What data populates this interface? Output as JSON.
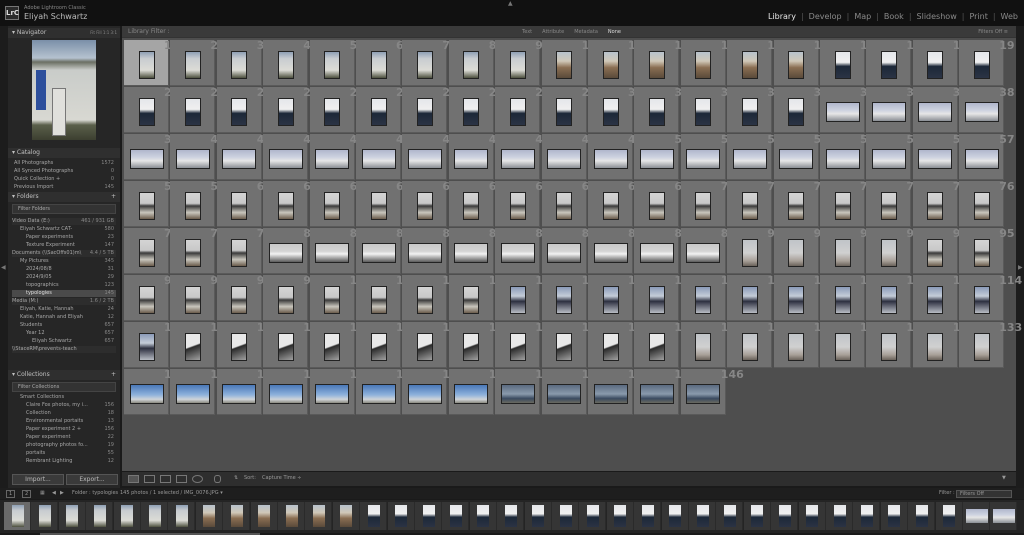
{
  "app": {
    "product": "Adobe Lightroom Classic",
    "user": "Eliyah Schwartz",
    "logo": "LrC"
  },
  "modules": [
    "Library",
    "Develop",
    "Map",
    "Book",
    "Slideshow",
    "Print",
    "Web"
  ],
  "active_module": "Library",
  "left_panel": {
    "navigator": {
      "title": "Navigator",
      "opts": "Fit  Fill  1:1  3:1"
    },
    "catalog": {
      "title": "Catalog",
      "items": [
        {
          "label": "All Photographs",
          "count": "1572"
        },
        {
          "label": "All Synced Photographs",
          "count": "0"
        },
        {
          "label": "Quick Collection +",
          "count": "0"
        },
        {
          "label": "Previous Import",
          "count": "145"
        }
      ]
    },
    "folders": {
      "title": "Folders",
      "filter": "Filter Folders",
      "items": [
        {
          "label": "Video Data (E:)",
          "count": "461 / 931 GB",
          "level": 0,
          "volume": true
        },
        {
          "label": "Eliyah Schwartz CAT-",
          "count": "580",
          "level": 1
        },
        {
          "label": "Paper experiments",
          "count": "23",
          "level": 2
        },
        {
          "label": "Texture Experiment",
          "count": "147",
          "level": 2
        },
        {
          "label": "Documents (\\\\SacOffs01)m\\",
          "count": "4.4 / 5 TB",
          "level": 0,
          "volume": true
        },
        {
          "label": "My Pictures",
          "count": "345",
          "level": 1
        },
        {
          "label": "2024/08/8",
          "count": "31",
          "level": 2
        },
        {
          "label": "2024/9/05",
          "count": "29",
          "level": 2
        },
        {
          "label": "topographics",
          "count": "123",
          "level": 2
        },
        {
          "label": "typologies",
          "count": "145",
          "level": 2,
          "selected": true
        },
        {
          "label": "Media (M:)",
          "count": "1.6 / 2 TB",
          "level": 0,
          "volume": true
        },
        {
          "label": "Eliyah, Katie, Hannah",
          "count": "24",
          "level": 1
        },
        {
          "label": "Katie, Hannah and Eliyah",
          "count": "12",
          "level": 1
        },
        {
          "label": "Students",
          "count": "657",
          "level": 1
        },
        {
          "label": "Year 12",
          "count": "657",
          "level": 2
        },
        {
          "label": "Eliyah Schwartz",
          "count": "657",
          "level": 3
        },
        {
          "label": "\\\\StaceRM\\prevents-teach",
          "count": "",
          "level": 0,
          "volume": true
        }
      ]
    },
    "collections": {
      "title": "Collections",
      "filter": "Filter Collections",
      "items": [
        {
          "label": "Smart Collections",
          "count": "",
          "level": 1
        },
        {
          "label": "Claire Fox photos, my i...",
          "count": "156",
          "level": 2
        },
        {
          "label": "Collection",
          "count": "18",
          "level": 2
        },
        {
          "label": "Environmental portaits",
          "count": "13",
          "level": 2
        },
        {
          "label": "Paper experiment 2 +",
          "count": "156",
          "level": 2
        },
        {
          "label": "Paper experiment",
          "count": "22",
          "level": 2
        },
        {
          "label": "photography photos fo...",
          "count": "19",
          "level": 2
        },
        {
          "label": "portaits",
          "count": "55",
          "level": 2
        },
        {
          "label": "Rembrant Lighting",
          "count": "12",
          "level": 2
        }
      ]
    },
    "buttons": {
      "import": "Import...",
      "export": "Export..."
    }
  },
  "filter_bar": {
    "title": "Library Filter :",
    "options": [
      "Text",
      "Attribute",
      "Metadata",
      "None"
    ],
    "active": "None",
    "right": "Filters Off ≡"
  },
  "grid": {
    "total": 145,
    "columns": 19,
    "selected": 1,
    "thumb_types": [
      "pdoor",
      "pdoor",
      "pdoor",
      "pdoor",
      "pdoor",
      "pdoor",
      "pdoor",
      "pdoor",
      "pdoor",
      "pshed",
      "pshed",
      "pshed",
      "pshed",
      "pshed",
      "pshed",
      "pdark",
      "pdark",
      "pdark",
      "pdark",
      "pdark",
      "pdark",
      "pdark",
      "pdark",
      "pdark",
      "pdark",
      "pdark",
      "pdark",
      "pdark",
      "pdark",
      "pdark",
      "pdark",
      "pdark",
      "pdark",
      "pdark",
      "lsilo",
      "lsilo",
      "lsilo",
      "lsilo",
      "lsilo",
      "lsilo",
      "lsilo",
      "lsilo",
      "lsilo",
      "lsilo",
      "lsilo",
      "lsilo",
      "lsilo",
      "lsilo",
      "lsilo",
      "lsilo",
      "lsilo",
      "lsilo",
      "lsilo",
      "lsilo",
      "lsilo",
      "lsilo",
      "lsilo",
      "pchim",
      "pchim",
      "pchim",
      "pchim",
      "pchim",
      "pchim",
      "pchim",
      "pchim",
      "pchim",
      "pchim",
      "pchim",
      "pchim",
      "pchim",
      "pchim",
      "pchim",
      "pchim",
      "pchim",
      "pchim",
      "pchim",
      "pchim",
      "pchim",
      "pchim",
      "lhouse",
      "lhouse",
      "lhouse",
      "lhouse",
      "lhouse",
      "lhouse",
      "lhouse",
      "lhouse",
      "lhouse",
      "lhouse",
      "pgrey",
      "pgrey",
      "pgrey",
      "pgrey",
      "pchim",
      "pchim",
      "pchim",
      "pchim",
      "pchim",
      "pchim",
      "pchim",
      "pchim",
      "pchim",
      "pchim",
      "pbld",
      "pbld",
      "pbld",
      "pbld",
      "pbld",
      "pbld",
      "pbld",
      "pbld",
      "pbld",
      "pbld",
      "pbld",
      "pbld",
      "pwalk",
      "pwalk",
      "pwalk",
      "pwalk",
      "pwalk",
      "pwalk",
      "pwalk",
      "pwalk",
      "pwalk",
      "pwalk",
      "pwalk",
      "pgrey",
      "pgrey",
      "pgrey",
      "pgrey",
      "pgrey",
      "pgrey",
      "pgrey",
      "lsky",
      "lsky",
      "lsky",
      "lsky",
      "lsky",
      "lsky",
      "lsky",
      "lsky",
      "lsea",
      "lsea",
      "lsea",
      "lsea",
      "lsea"
    ]
  },
  "toolbar": {
    "sort_label": "Sort:",
    "sort_value": "Capture Time ÷"
  },
  "status": {
    "page1": "1",
    "page2": "2",
    "folder": "Folder : typologies",
    "photos": "145 photos / 1 selected / IMG_0076.JPG ▾",
    "filter_label": "Filter :",
    "filter_value": "Filters Off"
  },
  "filmstrip": {
    "count": 37,
    "thumb_types": [
      "pdoor",
      "pdoor",
      "pdoor",
      "pdoor",
      "pdoor",
      "pdoor",
      "pdoor",
      "pshed",
      "pshed",
      "pshed",
      "pshed",
      "pshed",
      "pshed",
      "pdark",
      "pdark",
      "pdark",
      "pdark",
      "pdark",
      "pdark",
      "pdark",
      "pdark",
      "pdark",
      "pdark",
      "pdark",
      "pdark",
      "pdark",
      "pdark",
      "pdark",
      "pdark",
      "pdark",
      "pdark",
      "pdark",
      "pdark",
      "pdark",
      "pdark",
      "lsilo",
      "lsilo"
    ]
  },
  "colors": {
    "cell": "#717171",
    "selected": "#a5a5a5",
    "grid_bg": "#4e4e4e"
  }
}
